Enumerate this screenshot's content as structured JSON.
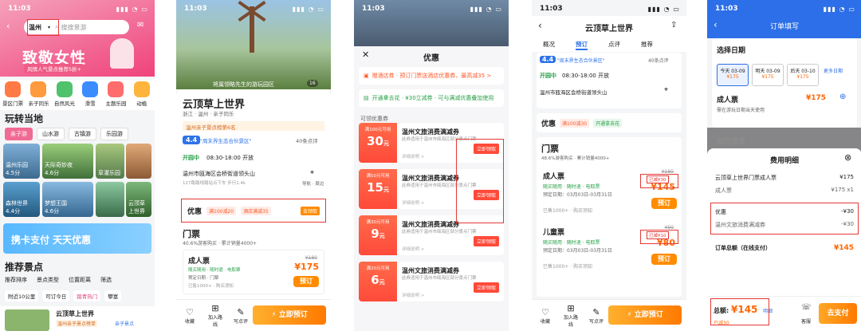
{
  "time": "11:03",
  "screen1": {
    "city": "温州",
    "search_placeholder": "搜搜景游",
    "banner_title": "致敬女性",
    "banner_sub": "风情人气景点推荐5折+",
    "categories": [
      "景区门票",
      "亲子同乐",
      "自然风光",
      "滑雪",
      "主题乐园",
      "动植"
    ],
    "section_title": "玩转当地",
    "tabs": [
      "亲子游",
      "山水游",
      "古镇游",
      "乐园游"
    ],
    "tiles": [
      {
        "name": "温州乐园",
        "score": "4.5分"
      },
      {
        "name": "天际奇妙夜",
        "score": "4.6分"
      },
      {
        "name": "草灌乐园",
        "score": ""
      },
      {
        "name": "森林世界",
        "score": "4.4分"
      },
      {
        "name": "梦想王国",
        "score": "4.6分"
      },
      {
        "name": "云顶草上世界",
        "score": ""
      }
    ],
    "promo": "携卡支付 天天优惠",
    "section2_title": "推荐景点",
    "filters": [
      "推荐排序",
      "景点类型",
      "位置距离",
      "筛选"
    ],
    "chips": [
      "附近10公里",
      "可订今日",
      "踏青热门",
      "攀富"
    ],
    "list_item": "云顶草上世界",
    "list_tag": "温州亲子景点榜单",
    "list_tag2": "亲子景点"
  },
  "screen2": {
    "hero_caption": "将属领略先生的游玩园区",
    "hero_count": "16",
    "title": "云顶草上世界",
    "meta": "浙江 · 温州 · 亲子同乐",
    "rank_bar": "温州亲子景点榜第6名",
    "score": "4.4",
    "score_text": "\"周末界生态合伙景区\"",
    "review_count": "40条点评",
    "open_label": "开园中",
    "open_time": "08:30-18:00 开放",
    "address": "温州市瓯海区会桥街道领头山",
    "address_sub": "127路路线路站点下车 步行1.4k",
    "nav_label": "导航 · 周边",
    "youhui": "优惠",
    "tag1": "满100减20",
    "tag2": "酒店满减35",
    "claim": "去领取",
    "ticket_header": "门票",
    "ticket_note": "40.6%游客购买 · 累计销量4000+",
    "ticket_name": "成人票",
    "ticket_tags": "随买随用 · 随时退 · 电取票",
    "ticket_date": "预定日期 · 门票",
    "ticket_sold": "已售1000+ · 购买须知",
    "orig_price": "¥180",
    "price": "¥175",
    "book": "预订",
    "bottom_icons": [
      "收藏",
      "加入路线",
      "写点评"
    ],
    "big_book": "立即预订"
  },
  "screen3": {
    "title": "优惠",
    "row1": "赠酒店券 · 预订门票送酒店优惠券，最高减35 >",
    "row2": "开通拿去花 · ¥30立减券 · 可与满减优惠叠加使用",
    "available_label": "可领优惠券",
    "coupons": [
      {
        "cond": "满100元可用",
        "amount": "30",
        "unit": "元",
        "name": "温州文旅消费满减券",
        "desc": "此券适用于温州市瓯海区部分景点门票",
        "detail": "详细说明 >",
        "claim": "立即领取"
      },
      {
        "cond": "满50元可用",
        "amount": "15",
        "unit": "元",
        "name": "温州文旅消费满减券",
        "desc": "此券适用于温州市瓯海区部分景点门票",
        "detail": "详细说明 >",
        "claim": "立即领取"
      },
      {
        "cond": "满30元可用",
        "amount": "9",
        "unit": "元",
        "name": "温州文旅消费满减券",
        "desc": "此券适用于温州市瓯海区部分景点门票",
        "detail": "详细说明 >",
        "claim": "立即领取"
      },
      {
        "cond": "满20元可用",
        "amount": "6",
        "unit": "元",
        "name": "温州文旅消费满减券",
        "desc": "此券适用于温州市瓯海区部分景点门票",
        "detail": "详细说明 >",
        "claim": "立即领取"
      }
    ]
  },
  "screen4": {
    "nav_title": "云顶草上世界",
    "subtabs": [
      "概况",
      "预订",
      "点评",
      "推荐"
    ],
    "score": "4.4",
    "score_text": "\"周末界生态合伙景区\"",
    "reviews": "40条点评",
    "open_label": "开园中",
    "open_time": "08:30-18:00 开放",
    "address": "温州市瓯海区会桥街道领头山",
    "youhui": "优惠",
    "tag1": "满100减30",
    "tag2": "开通拿去花",
    "mp_header": "门票",
    "mp_note": "48.6%游客购买 · 累计销量4000+",
    "adult": "成人票",
    "adult_orig": "¥180",
    "adult_badge": "已减¥30",
    "adult_price": "¥145",
    "child": "儿童票",
    "child_orig": "¥90",
    "child_badge": "已减¥10",
    "child_price": "¥80",
    "tags": "随买随用 · 随时退 · 电取票",
    "date": "预定日期：03月03日-03月31日",
    "sold": "已售1000+ · 购买须知",
    "book": "预订",
    "bottom_icons": [
      "收藏",
      "加入路线",
      "写点评"
    ],
    "big_book": "立即预订"
  },
  "screen5": {
    "nav_title": "订单填写",
    "select_date": "选择日期",
    "dates": [
      {
        "label": "今天 03-09",
        "price": "¥175"
      },
      {
        "label": "明天 03-09",
        "price": "¥175"
      },
      {
        "label": "后天 03-10",
        "price": "¥175"
      }
    ],
    "more_dates": "更多日期",
    "ticket": "成人票",
    "ticket_price": "¥175",
    "ticket_note": "需在游玩日期当天使用",
    "trip_info": "出行信息",
    "modal_title": "费用明细",
    "row1_label": "云顶草上世界门票成人票",
    "row1_value": "¥175",
    "row2_label": "成人票",
    "row2_value": "¥175 x1",
    "row3_label": "优惠",
    "row3_value": "-¥30",
    "row4_label": "温州文旅消费满减券",
    "row4_value": "-¥30",
    "total_label": "订单总额（在线支付）",
    "total_value": "¥145",
    "bottom_total_label": "总额:",
    "bottom_total": "¥145",
    "bottom_detail": "明细",
    "bottom_saved": "已减30",
    "service": "客服",
    "pay": "去支付"
  }
}
